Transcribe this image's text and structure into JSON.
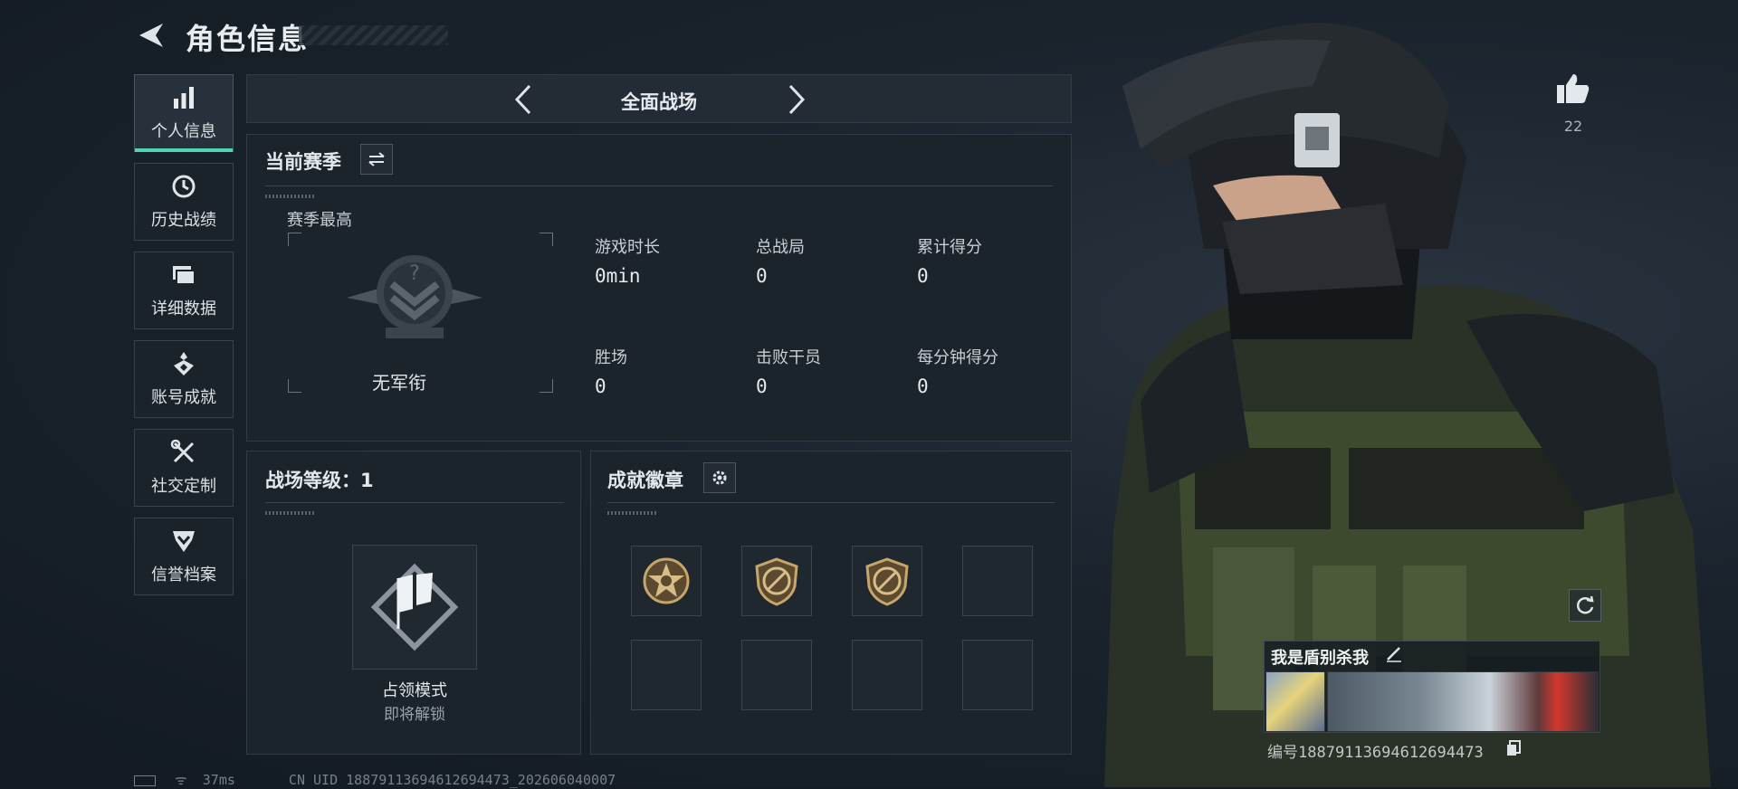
{
  "header": {
    "title": "角色信息",
    "back_icon": "back-arrow-icon"
  },
  "sidebar": {
    "items": [
      {
        "label": "个人信息",
        "icon": "bar-chart-icon",
        "active": true
      },
      {
        "label": "历史战绩",
        "icon": "history-clock-icon",
        "active": false
      },
      {
        "label": "详细数据",
        "icon": "folder-stack-icon",
        "active": false
      },
      {
        "label": "账号成就",
        "icon": "achievement-medal-icon",
        "active": false
      },
      {
        "label": "社交定制",
        "icon": "tools-icon",
        "active": false
      },
      {
        "label": "信誉档案",
        "icon": "reputation-shield-icon",
        "active": false
      }
    ]
  },
  "mode_selector": {
    "label": "全面战场"
  },
  "season": {
    "title": "当前赛季",
    "best_label": "赛季最高",
    "rank_name": "无军衔",
    "stats": [
      {
        "label": "游戏时长",
        "value": "0min"
      },
      {
        "label": "总战局",
        "value": "0"
      },
      {
        "label": "累计得分",
        "value": "0"
      },
      {
        "label": "胜场",
        "value": "0"
      },
      {
        "label": "击败干员",
        "value": "0"
      },
      {
        "label": "每分钟得分",
        "value": "0"
      }
    ]
  },
  "battlefield_level": {
    "title": "战场等级：1",
    "mode_name": "占领模式",
    "mode_status": "即将解锁"
  },
  "badges": {
    "title": "成就徽章",
    "slots": [
      "star-badge-icon",
      "no-knife-badge-icon",
      "no-knife-badge-icon",
      "",
      "",
      "",
      "",
      ""
    ]
  },
  "profile": {
    "like_count": "22",
    "player_name": "我是盾别杀我",
    "uid_text": "编号1887911369461269447З",
    "uid_display": "编号1887911369461269447З"
  },
  "status_bar": {
    "ping": "37ms",
    "uid_line": "CN UID 1887911369461269447З_202606040007"
  },
  "colors": {
    "accent": "#4fd6b0",
    "panel": "#1b232b",
    "border": "#313b45"
  }
}
